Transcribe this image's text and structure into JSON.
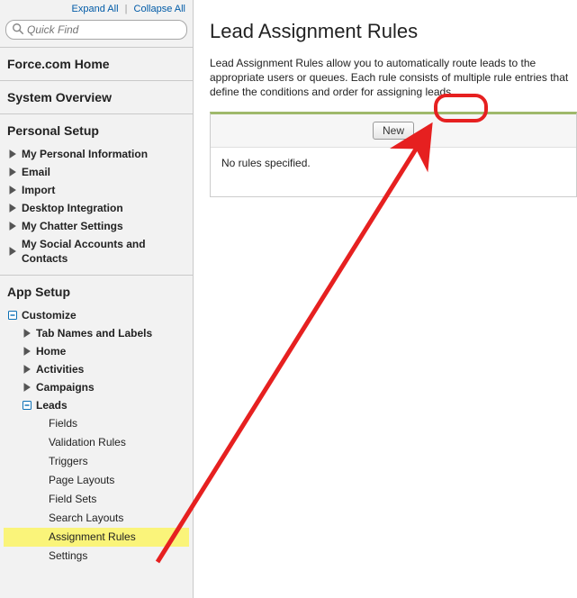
{
  "topLinks": {
    "expand": "Expand All",
    "collapse": "Collapse All"
  },
  "search": {
    "placeholder": "Quick Find"
  },
  "sections": {
    "home": "Force.com Home",
    "system": "System Overview",
    "personal": "Personal Setup",
    "app": "App Setup"
  },
  "personalItems": [
    "My Personal Information",
    "Email",
    "Import",
    "Desktop Integration",
    "My Chatter Settings",
    "My Social Accounts and Contacts"
  ],
  "appTree": {
    "customize": "Customize",
    "children": [
      "Tab Names and Labels",
      "Home",
      "Activities",
      "Campaigns"
    ],
    "leads": "Leads",
    "leadsChildren": [
      "Fields",
      "Validation Rules",
      "Triggers",
      "Page Layouts",
      "Field Sets",
      "Search Layouts",
      "Assignment Rules",
      "Settings"
    ],
    "activeLeaf": "Assignment Rules"
  },
  "page": {
    "title": "Lead Assignment Rules",
    "desc": "Lead Assignment Rules allow you to automatically route leads to the appropriate users or queues. Each rule consists of multiple rule entries that define the conditions and order for assigning leads.",
    "newBtn": "New",
    "empty": "No rules specified."
  }
}
